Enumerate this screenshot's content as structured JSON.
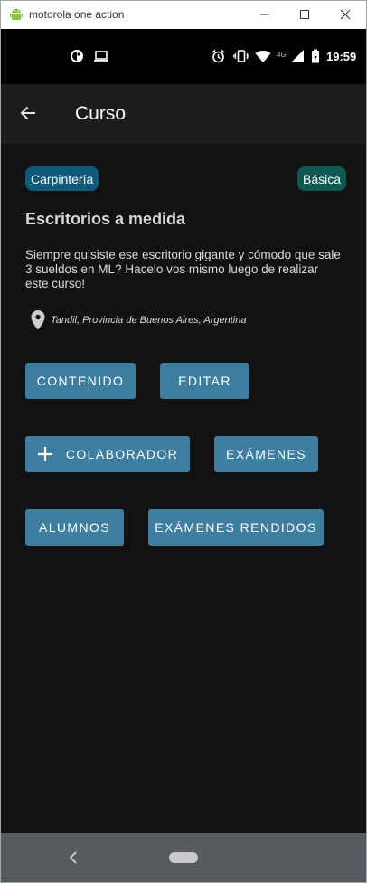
{
  "window": {
    "title": "motorola one action",
    "controls": {
      "minimize_icon": "minimize-icon",
      "maximize_icon": "maximize-icon",
      "close_icon": "close-icon"
    }
  },
  "status_bar": {
    "time": "19:59",
    "network": "4G",
    "icons": [
      "app-status-icon",
      "cast-icon",
      "alarm-icon",
      "vibrate-icon",
      "wifi-icon",
      "signal-icon",
      "battery-icon"
    ]
  },
  "app_bar": {
    "title": "Curso",
    "back_icon": "arrow-back-icon"
  },
  "course": {
    "category": "Carpintería",
    "level": "Básica",
    "title": "Escritorios a medida",
    "description": "Siempre quisiste ese escritorio gigante y cómodo que sale 3 sueldos en ML? Hacelo vos mismo luego de realizar este curso!",
    "location": "Tandil, Provincia de Buenos Aires, Argentina"
  },
  "actions": {
    "contenido": "CONTENIDO",
    "editar": "EDITAR",
    "colaborador": "COLABORADOR",
    "examenes": "EXÁMENES",
    "alumnos": "ALUMNOS",
    "examenes_rendidos": "EXÁMENES RENDIDOS"
  },
  "colors": {
    "background": "#121212",
    "app_bar": "#1c1c1c",
    "button": "#3d7fa1",
    "chip_category": "#0e5a7a",
    "chip_level": "#0c5a52",
    "nav_bar": "#565b5e"
  }
}
